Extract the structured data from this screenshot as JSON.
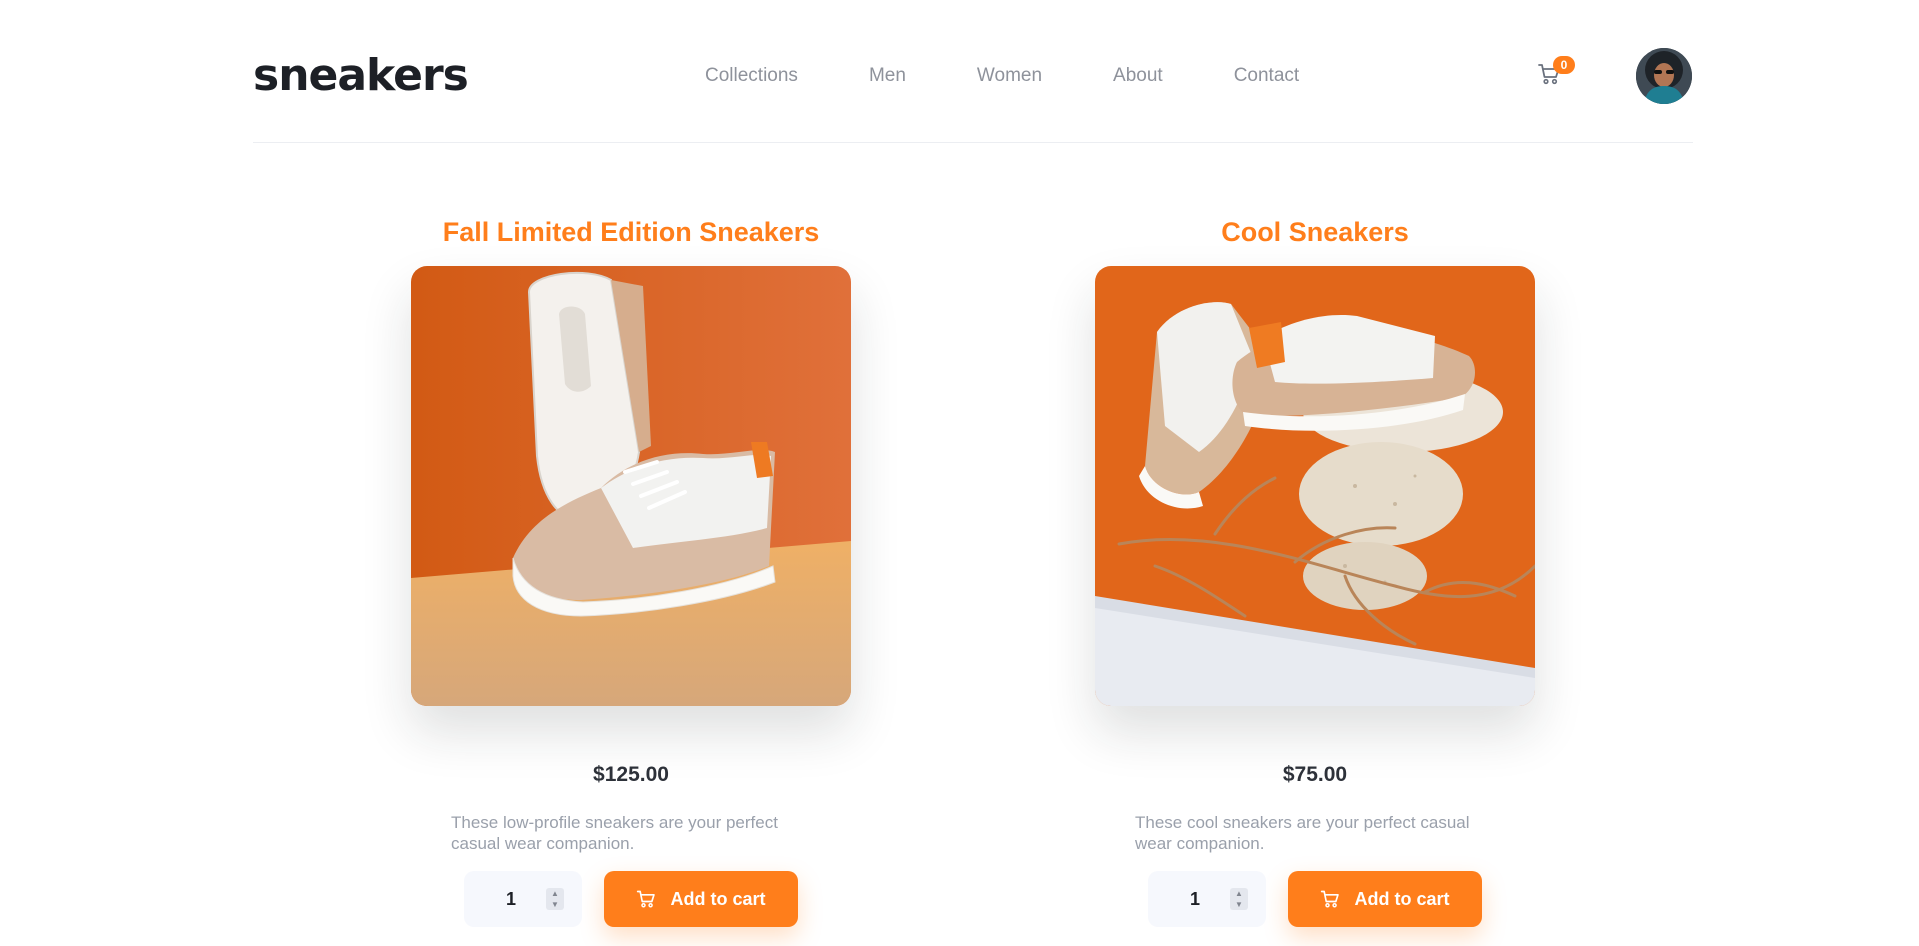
{
  "header": {
    "logo": "sneakers",
    "nav": [
      "Collections",
      "Men",
      "Women",
      "About",
      "Contact"
    ],
    "cart_count": "0"
  },
  "products": [
    {
      "title": "Fall Limited Edition Sneakers",
      "price": "$125.00",
      "description": "These low-profile sneakers are your perfect casual wear companion.",
      "quantity": "1",
      "button_label": "Add to cart"
    },
    {
      "title": "Cool Sneakers",
      "price": "$75.00",
      "description": "These cool sneakers are your perfect casual wear companion.",
      "quantity": "1",
      "button_label": "Add to cart"
    }
  ],
  "colors": {
    "accent": "#ff7e1b",
    "text_dark": "#1d2026",
    "text_muted": "#8e929b",
    "qty_bg": "#f6f8fd"
  },
  "icons": {
    "header_cart": "cart-icon",
    "button_cart": "cart-icon",
    "spinner": "chevron-up-down-icon"
  }
}
